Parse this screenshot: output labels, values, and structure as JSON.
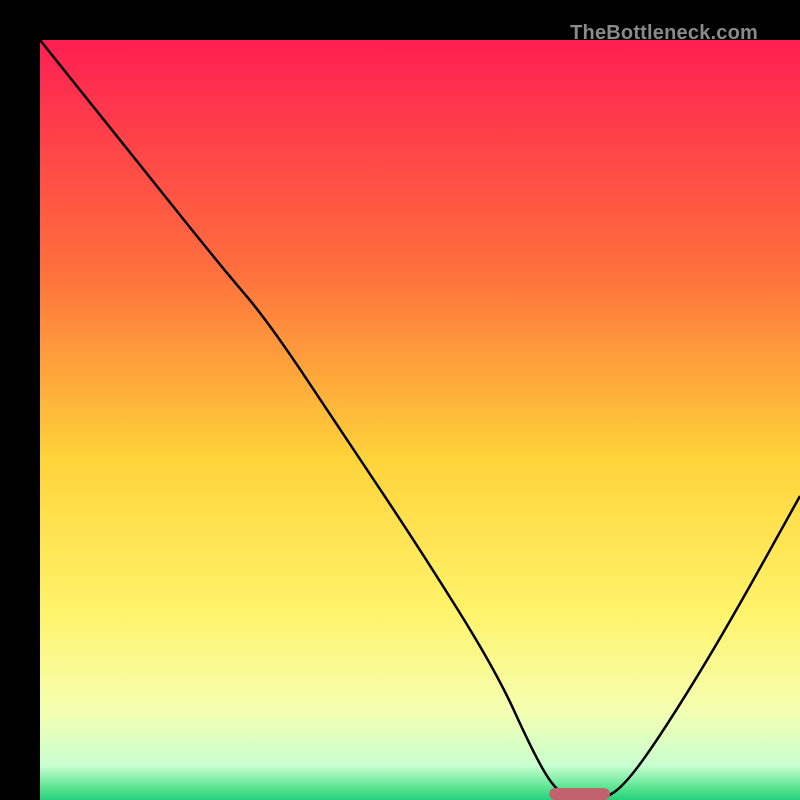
{
  "watermark": "TheBottleneck.com",
  "chart_data": {
    "type": "line",
    "title": "",
    "xlabel": "",
    "ylabel": "",
    "xlim": [
      0,
      100
    ],
    "ylim": [
      0,
      100
    ],
    "legend": false,
    "grid": false,
    "background_gradient": {
      "stops": [
        {
          "offset": 0.0,
          "color": "#ff1f52"
        },
        {
          "offset": 0.3,
          "color": "#ff6e3d"
        },
        {
          "offset": 0.55,
          "color": "#ffd33a"
        },
        {
          "offset": 0.75,
          "color": "#fff36a"
        },
        {
          "offset": 0.88,
          "color": "#f6ffb0"
        },
        {
          "offset": 0.955,
          "color": "#c8ffd0"
        },
        {
          "offset": 0.985,
          "color": "#57e38f"
        },
        {
          "offset": 1.0,
          "color": "#26d07c"
        }
      ]
    },
    "minimum_marker": {
      "x": 71,
      "y": 0,
      "width": 8,
      "color": "#c0636e"
    },
    "series": [
      {
        "name": "bottleneck-curve",
        "color": "#000000",
        "points": [
          {
            "x": 0,
            "y": 100
          },
          {
            "x": 12,
            "y": 85
          },
          {
            "x": 24,
            "y": 70
          },
          {
            "x": 30,
            "y": 63
          },
          {
            "x": 40,
            "y": 48
          },
          {
            "x": 50,
            "y": 33
          },
          {
            "x": 60,
            "y": 17
          },
          {
            "x": 65,
            "y": 6
          },
          {
            "x": 68,
            "y": 1
          },
          {
            "x": 71,
            "y": 0
          },
          {
            "x": 74,
            "y": 0
          },
          {
            "x": 77,
            "y": 2
          },
          {
            "x": 82,
            "y": 9
          },
          {
            "x": 90,
            "y": 22
          },
          {
            "x": 100,
            "y": 40
          }
        ]
      }
    ]
  }
}
